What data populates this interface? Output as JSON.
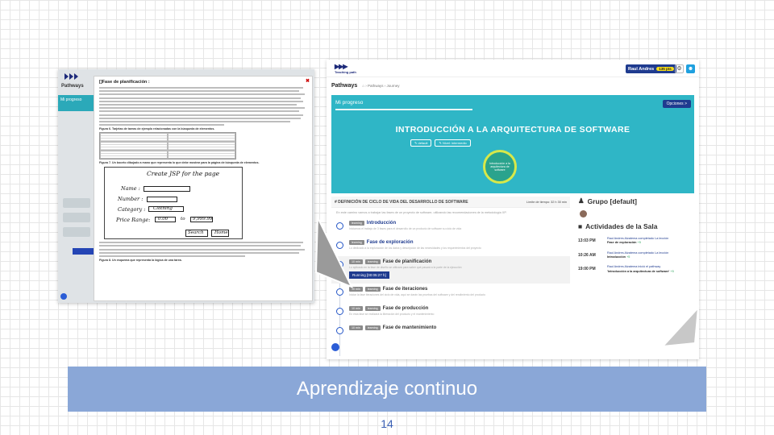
{
  "left_screen": {
    "pathways_label": "Pathways",
    "progress_label": "Mi progreso",
    "doc_title": "[]Fase de planificación :",
    "close_symbol": "✖",
    "table_caption": "Figura 6. Tarjetas de tareas de ejemplo relacionadas con la búsqueda de elementos.",
    "sketch_caption": "Figura 7. Un boceto dibujado a mano que representa lo que debe mostrar para la página de búsqueda de elementos.",
    "final_caption": "Figura 8. Un esquema que representa la lógica de una tarea.",
    "sketch": {
      "title": "Create JSP for the page",
      "name": "Name :",
      "number": "Number :",
      "category": "Category :",
      "category_value": "Clothing",
      "price_range": "Price Range:",
      "price_from": "0.00",
      "price_to": "to",
      "price_max": "9,999.99",
      "search": "Search",
      "home": "Home"
    }
  },
  "right_screen": {
    "logo_text": "Teaching path",
    "user_name": "Raul Andres",
    "points": "135 pts",
    "pathways_label": "Pathways",
    "breadcrumb": "⌂  ›  Pathways  ›  Journey",
    "my_progress": "Mi progreso",
    "options_button": "Opciones >",
    "course_title": "INTRODUCCIÓN A LA ARQUITECTURA DE SOFTWARE",
    "tag_default": "✎ default",
    "tag_level": "✎ Nivel: intermedio",
    "circle_text": "Introducción a la arquitectura de software",
    "stage_title": "# DEFINICIÓN DE CICLO DE VIDA DEL DESARROLLO DE SOFTWARE",
    "stage_limit": "Límite de tiempo: 32 h 30 min",
    "stage_desc": "En este camino vamos a trabajar las fases de un proyecto de software, utilizando las recomendaciones de la metodología XP.",
    "activities": [
      {
        "time": "",
        "badge": "learning",
        "name": "Introducción",
        "desc": "Iniciamos el trabajo de 3 fases para el desarrollo de un producto de software su ciclo de vida",
        "highlight": false,
        "blue": true
      },
      {
        "time": "",
        "badge": "learning",
        "name": "Fase de exploración",
        "desc": "Lo dedicado a la exploración de los datos y descripción de las necesidades y los requerimientos del proyecto",
        "highlight": false,
        "blue": true
      },
      {
        "time": "10 min",
        "badge": "learning",
        "name": "Fase de planificación",
        "desc": "Lo aplicado en la fase de diseño se utilizará para saber qué pasará a la parte de la ejecución",
        "highlight": true,
        "blue": false
      },
      {
        "time": "10 min",
        "badge": "learning",
        "name": "Fase de iteraciones",
        "desc": "Iniciar la fase iteraciones del ciclo de vida, aquí se darán las pruebas del software y del rendimiento del producto",
        "highlight": false,
        "blue": false
      },
      {
        "time": "10 min",
        "badge": "learning",
        "name": "Fase de producción",
        "desc": "En esta fase se realizará la liberación del producto y el mantenimiento",
        "highlight": false,
        "blue": false
      },
      {
        "time": "10 min",
        "badge": "learning",
        "name": "Fase de mantenimiento",
        "desc": "",
        "highlight": false,
        "blue": false
      }
    ],
    "running_label": "Running [00:05:27 h]",
    "group_title": "Grupo [default]",
    "activity_title": "Actividades de la Sala",
    "feed": [
      {
        "time": "13:03 PM",
        "line1": "Raul Andres Alzatema completado La lección",
        "line2": "Fase de exploración",
        "points": "+5"
      },
      {
        "time": "10:26 AM",
        "line1": "Raul Andres Alzatema completado La lección",
        "line2": "Introducción",
        "points": "+5"
      },
      {
        "time": "19:00 PM",
        "line1": "Raul Andres Alzatema inició el pathway",
        "line2": "'Introducción a la arquitectura de software'",
        "points": "+5"
      }
    ]
  },
  "footer": {
    "banner_text": "Aprendizaje continuo",
    "page_number": "14"
  },
  "colors": {
    "banner": "#8aa7d7",
    "teal": "#2fb6c6",
    "navy": "#1f3b8f",
    "page_number": "#3a5fb3"
  }
}
